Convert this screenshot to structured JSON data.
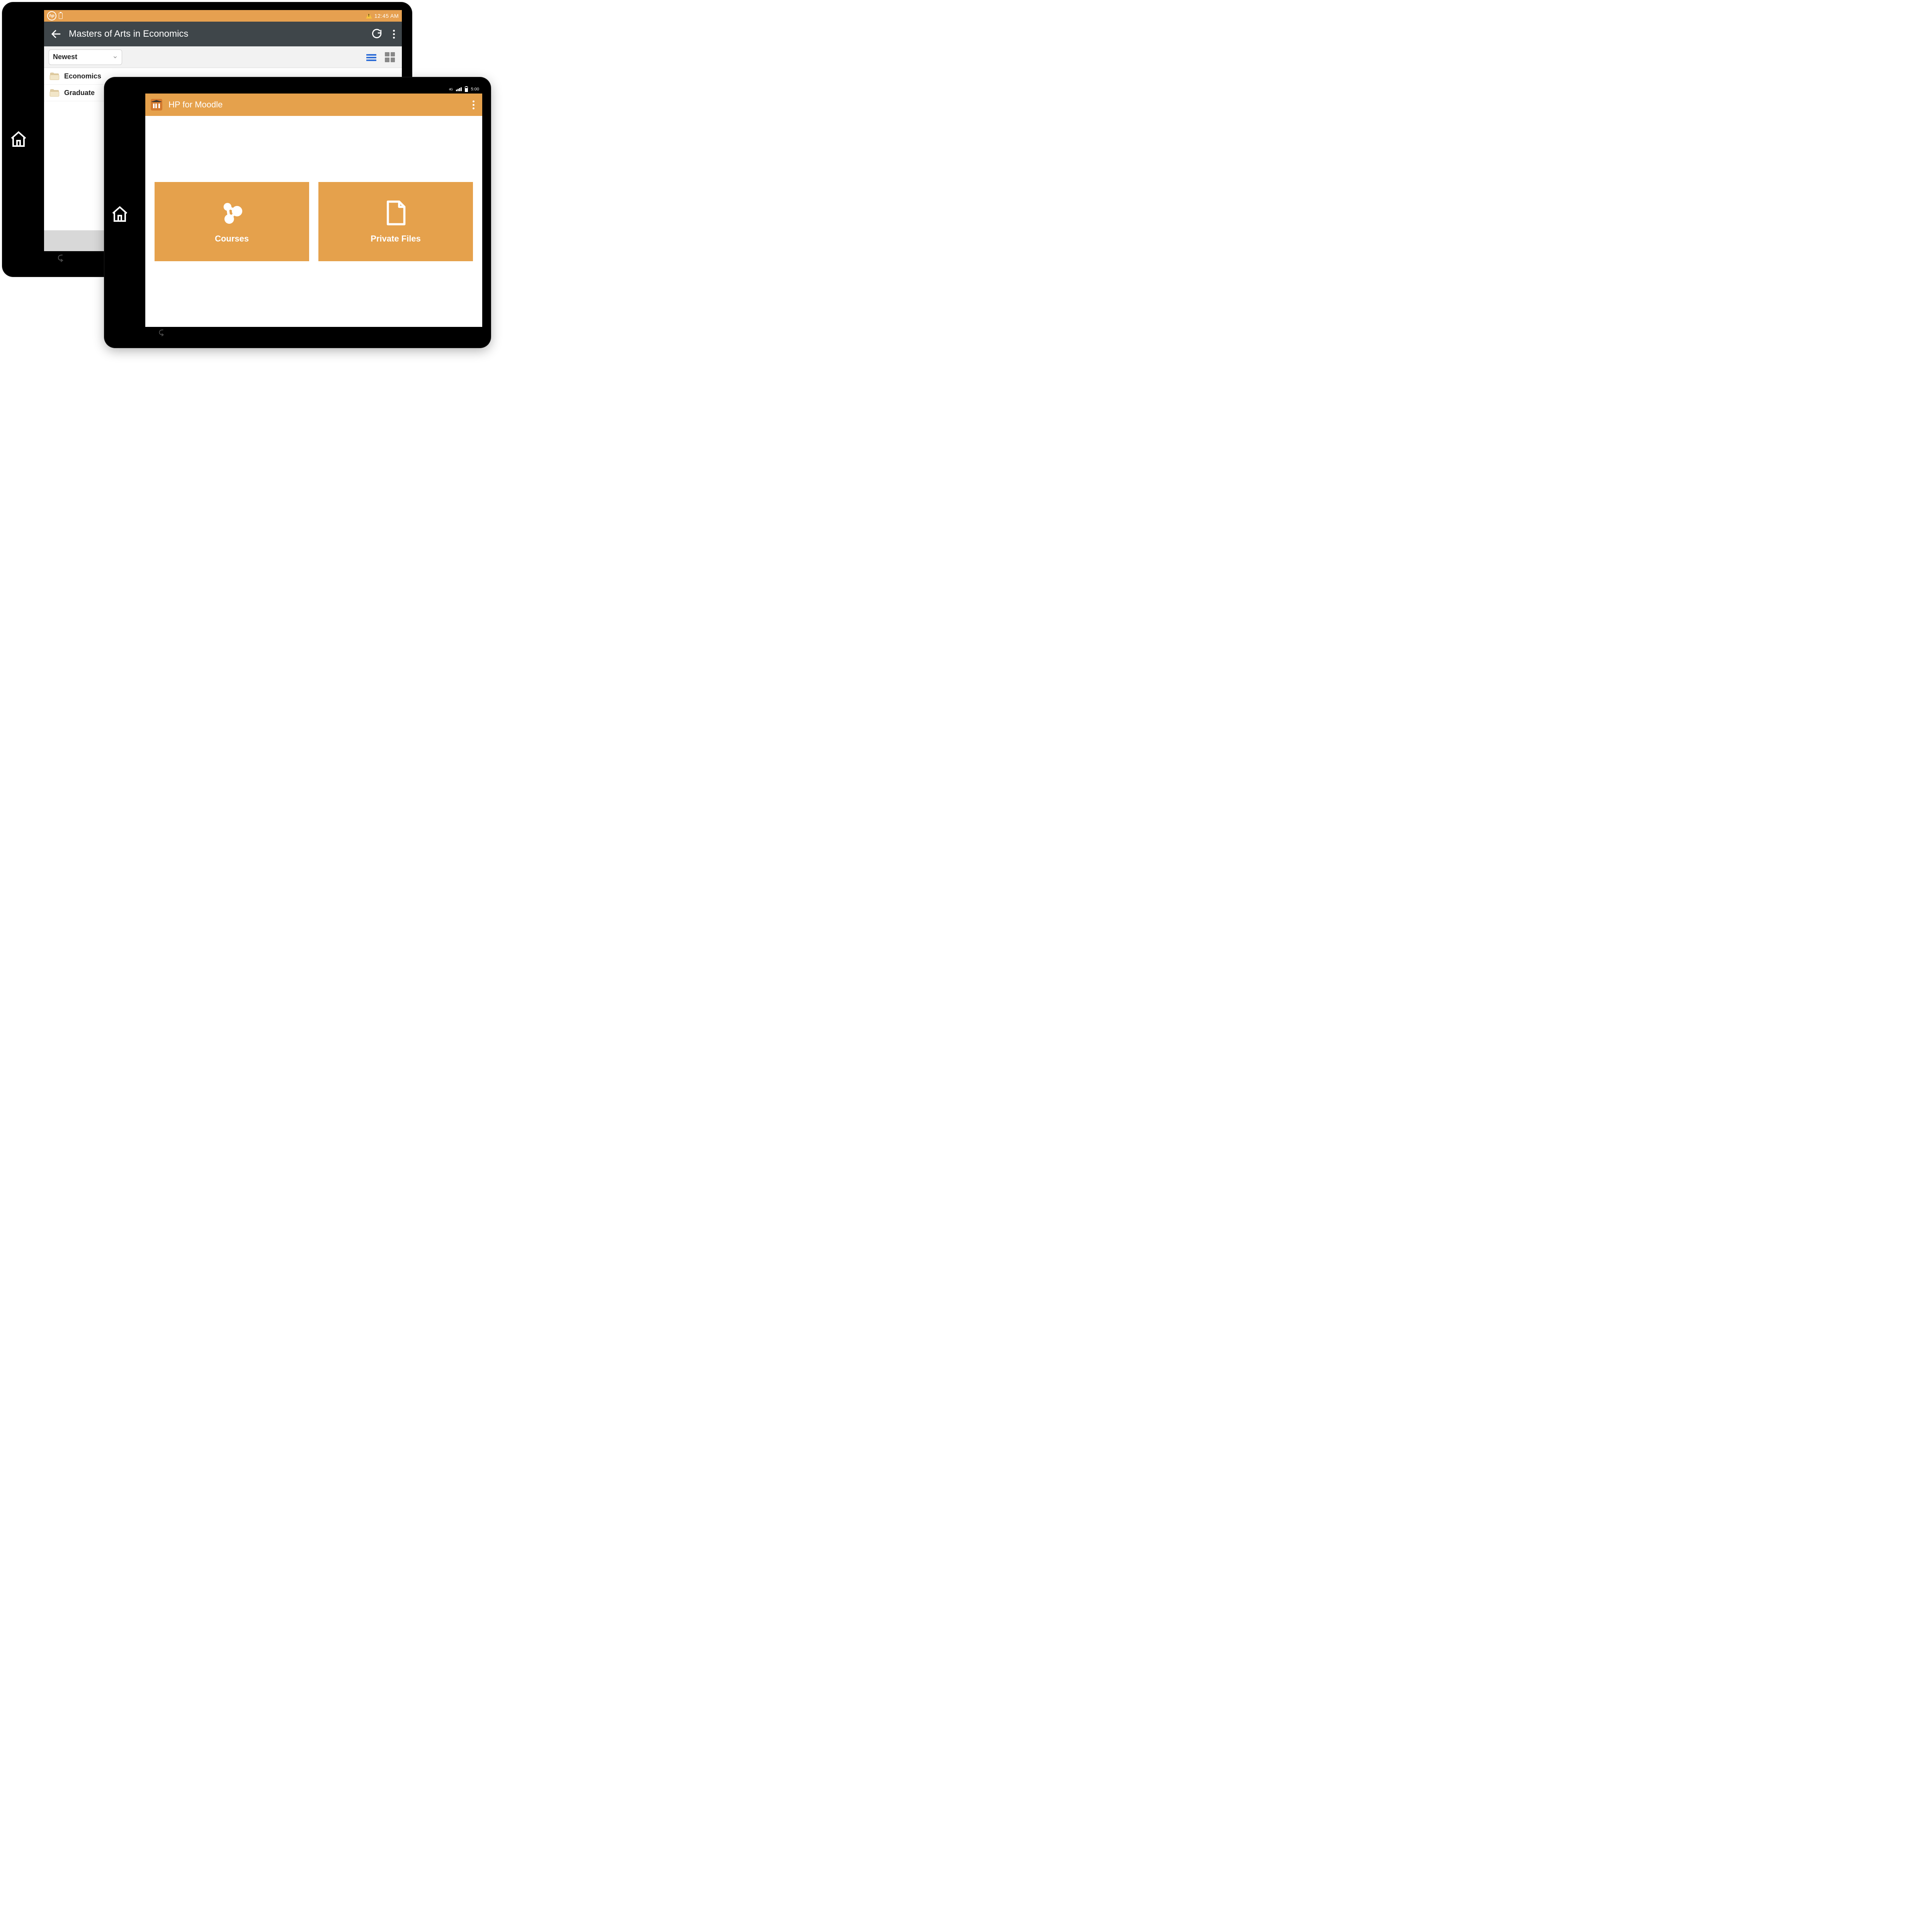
{
  "back": {
    "statusbar": {
      "time": "12:45 AM"
    },
    "title": "Masters of Arts in Economics",
    "sort_label": "Newest",
    "items": [
      {
        "label": "Economics"
      },
      {
        "label": "Graduate "
      }
    ]
  },
  "front": {
    "statusbar": {
      "network": "4G",
      "time": "5:00"
    },
    "app_title": "HP for Moodle",
    "tiles": [
      {
        "label": "Courses"
      },
      {
        "label": "Private Files"
      }
    ]
  }
}
